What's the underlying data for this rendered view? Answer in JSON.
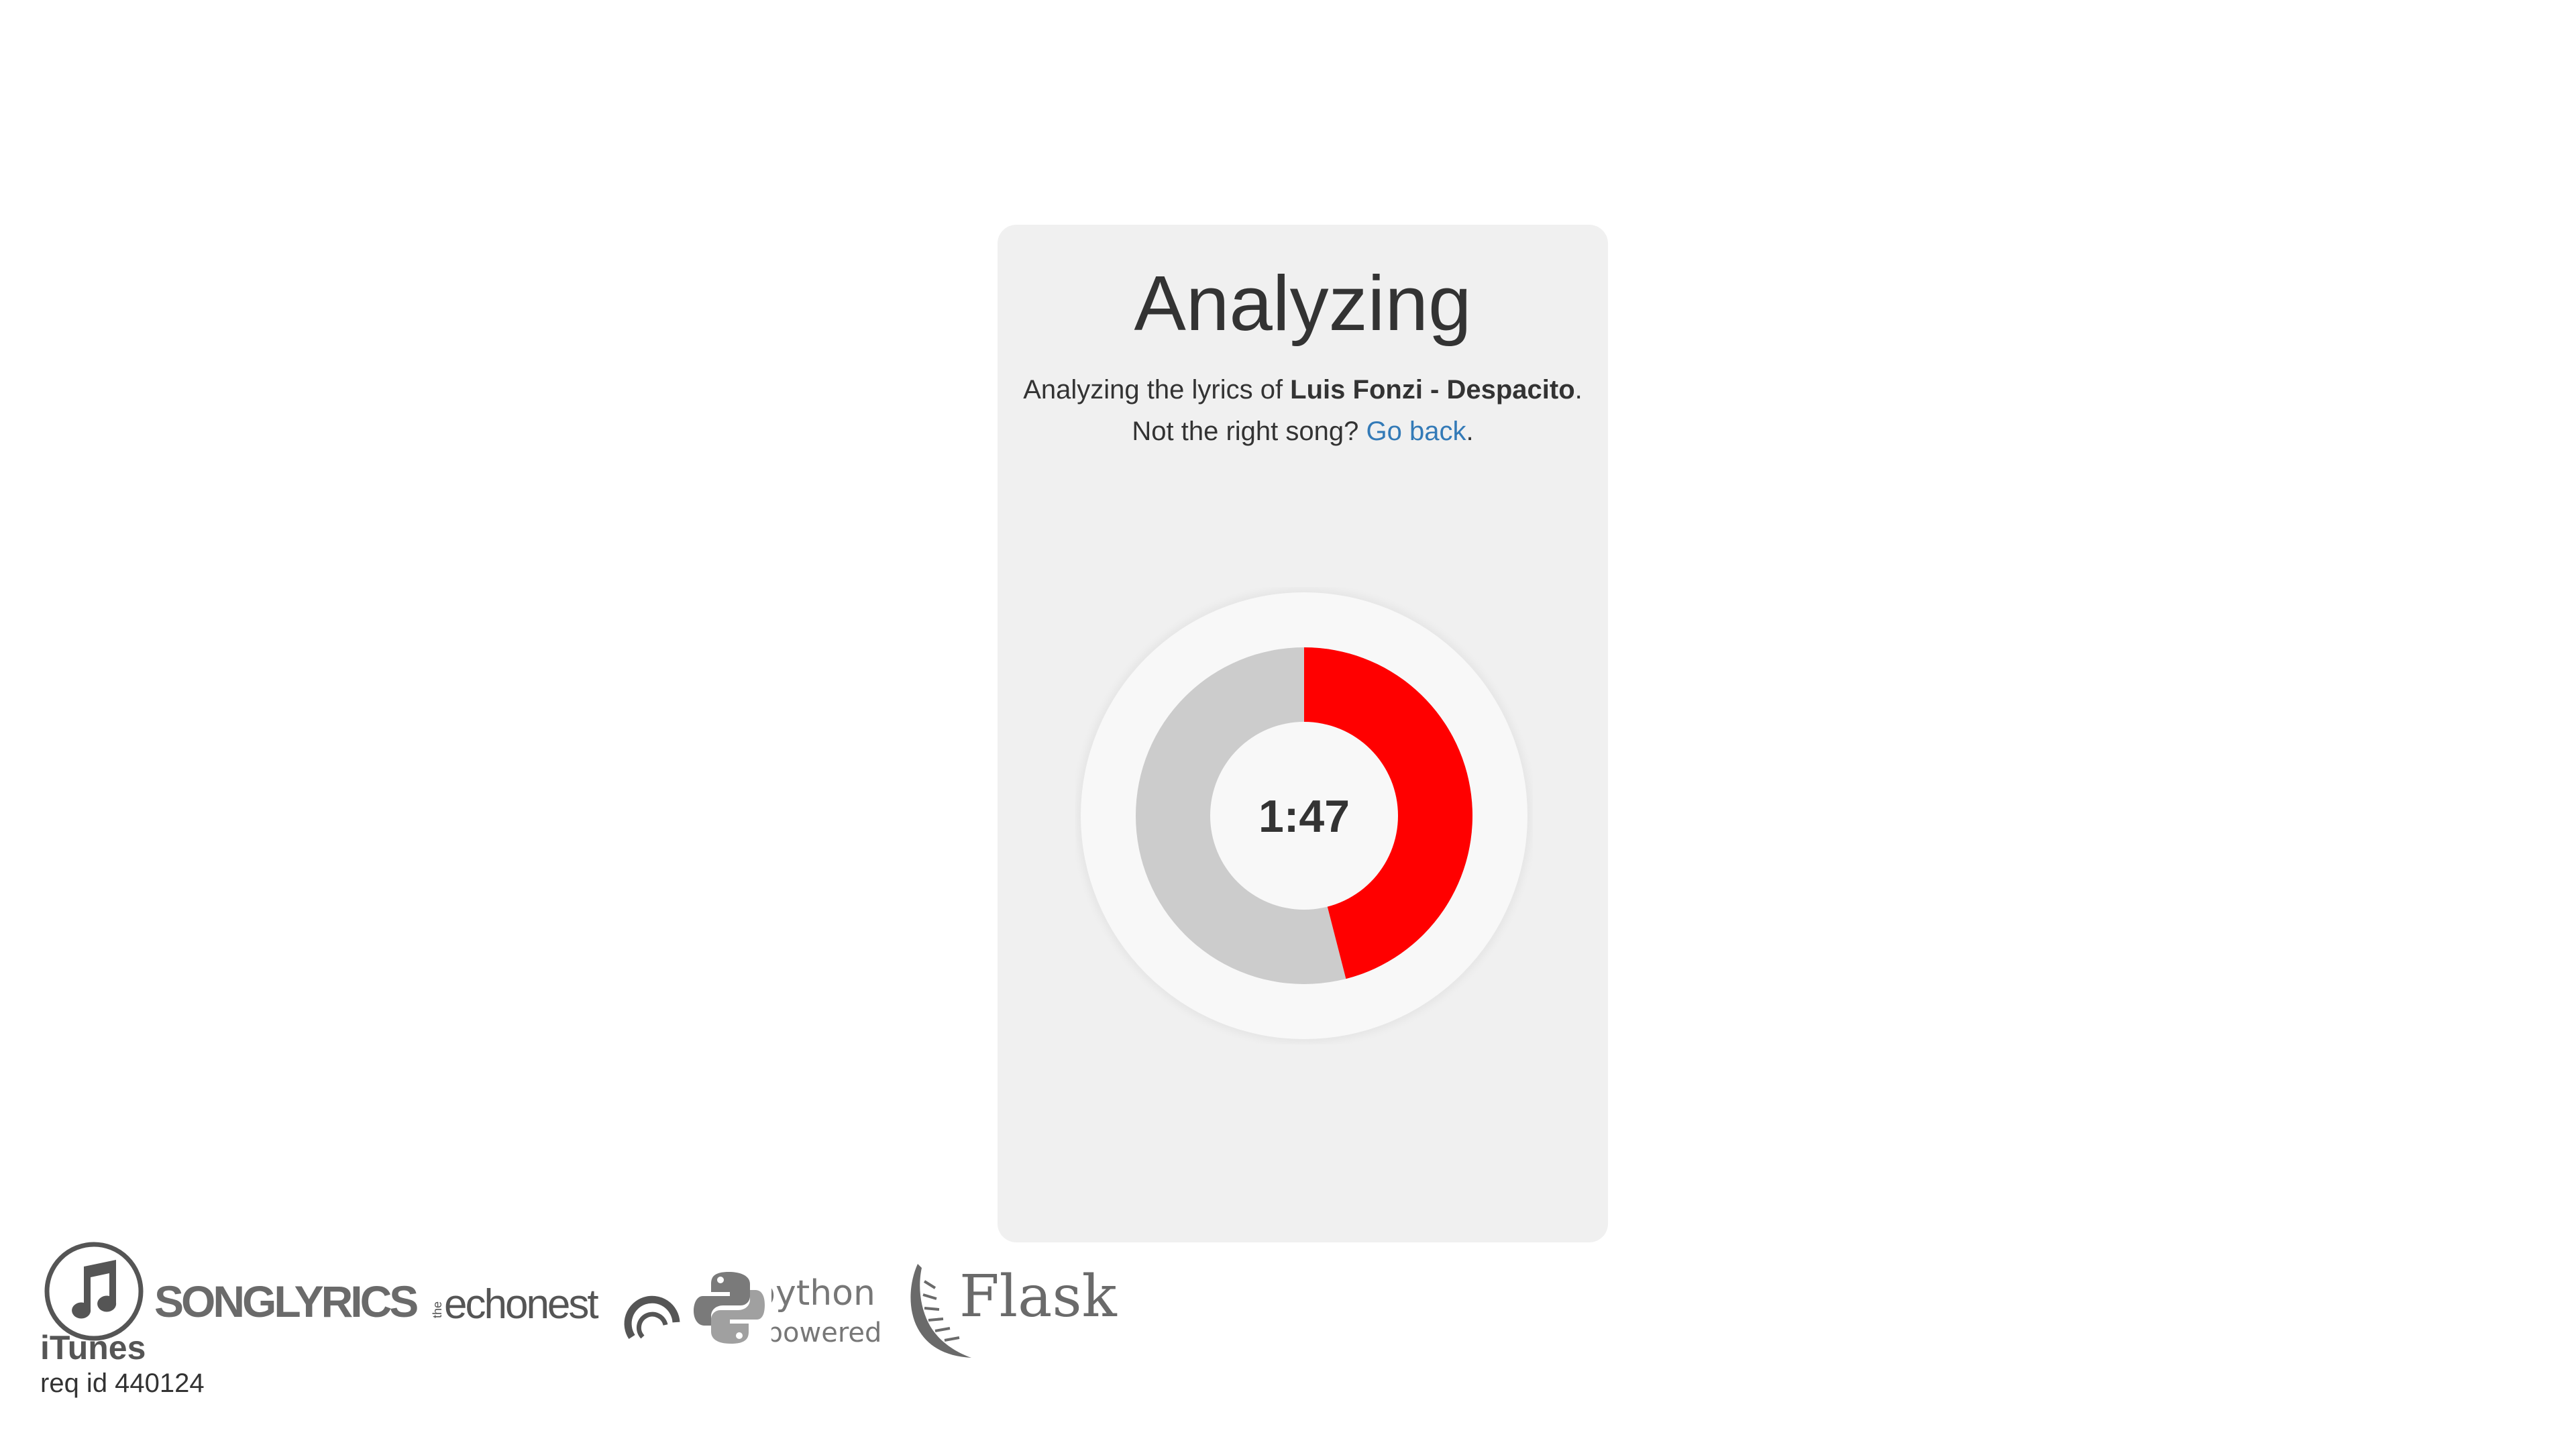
{
  "card": {
    "title": "Analyzing",
    "line1_prefix": "Analyzing the lyrics of ",
    "song": "Luis Fonzi - Despacito",
    "line1_suffix": ".",
    "line2_prefix": "Not the right song? ",
    "go_back": "Go back",
    "line2_suffix": "."
  },
  "timer": {
    "time": "1:47",
    "progress_fraction": 0.46,
    "progress_color": "#ff0000",
    "track_color": "#cccccc"
  },
  "footer": {
    "itunes_label": "iTunes",
    "songlyrics_label": "SONGLYRICS",
    "echonest_prefix": "the",
    "echonest_label": "echonest",
    "python_top": "python",
    "python_bottom": "powered",
    "flask_label": "Flask",
    "req_id": "req id 440124"
  },
  "icons": [
    "itunes-note-icon",
    "echonest-arc-icon",
    "python-snakes-icon",
    "flask-horn-icon"
  ]
}
